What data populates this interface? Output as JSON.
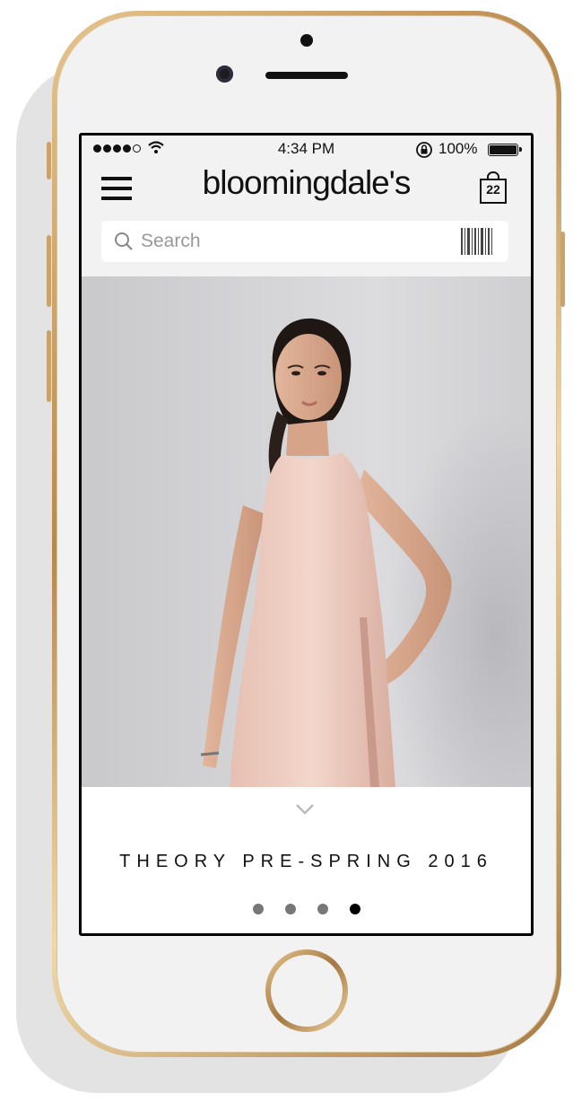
{
  "status_bar": {
    "time": "4:34 PM",
    "battery": "100%"
  },
  "header": {
    "logo": "bloomingdale's",
    "bag_count": "22"
  },
  "search": {
    "placeholder": "Search"
  },
  "hero": {
    "image": "model-in-pink-sleeveless-dress"
  },
  "carousel": {
    "headline": "THEORY PRE-SPRING 2016",
    "pages": 4,
    "active_page": 4
  },
  "colors": {
    "gold_frame": "#c9a36b",
    "screen_bg": "#f2f2f2",
    "dress_pink": "#efcdc2"
  }
}
